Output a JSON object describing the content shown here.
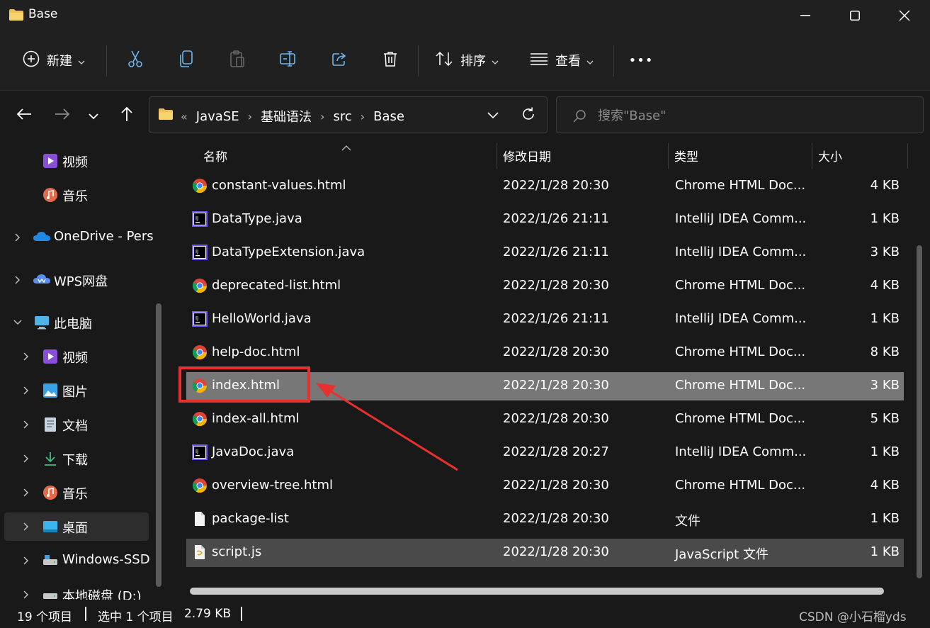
{
  "window": {
    "title": "Base"
  },
  "toolbar": {
    "new_label": "新建",
    "sort_label": "排序",
    "view_label": "查看",
    "more_label": "•••"
  },
  "address": {
    "lead": "«",
    "crumbs": [
      "JavaSE",
      "基础语法",
      "src",
      "Base"
    ]
  },
  "search": {
    "placeholder": "搜索\"Base\""
  },
  "sidebar": {
    "items": [
      {
        "label": "视频",
        "icon": "video-icon"
      },
      {
        "label": "音乐",
        "icon": "music-icon"
      },
      {
        "label": "OneDrive - Pers",
        "icon": "onedrive-icon"
      },
      {
        "label": "WPS网盘",
        "icon": "wps-cloud-icon"
      },
      {
        "label": "此电脑",
        "icon": "computer-icon"
      },
      {
        "label": "视频",
        "icon": "video-icon"
      },
      {
        "label": "图片",
        "icon": "pictures-icon"
      },
      {
        "label": "文档",
        "icon": "documents-icon"
      },
      {
        "label": "下载",
        "icon": "download-icon"
      },
      {
        "label": "音乐",
        "icon": "music-icon"
      },
      {
        "label": "桌面",
        "icon": "desktop-icon"
      },
      {
        "label": "Windows-SSD",
        "icon": "drive-icon"
      },
      {
        "label": "本地磁盘 (D:)",
        "icon": "drive-icon"
      }
    ]
  },
  "columns": {
    "name": "名称",
    "modified": "修改日期",
    "type": "类型",
    "size": "大小"
  },
  "files": [
    {
      "name": "constant-values.html",
      "modified": "2022/1/28 20:30",
      "type": "Chrome HTML Doc...",
      "size": "4 KB",
      "icon": "chrome-icon"
    },
    {
      "name": "DataType.java",
      "modified": "2022/1/26 21:11",
      "type": "IntelliJ IDEA Comm...",
      "size": "1 KB",
      "icon": "intellij-icon"
    },
    {
      "name": "DataTypeExtension.java",
      "modified": "2022/1/26 21:11",
      "type": "IntelliJ IDEA Comm...",
      "size": "3 KB",
      "icon": "intellij-icon"
    },
    {
      "name": "deprecated-list.html",
      "modified": "2022/1/28 20:30",
      "type": "Chrome HTML Doc...",
      "size": "4 KB",
      "icon": "chrome-icon"
    },
    {
      "name": "HelloWorld.java",
      "modified": "2022/1/26 21:11",
      "type": "IntelliJ IDEA Comm...",
      "size": "1 KB",
      "icon": "intellij-icon"
    },
    {
      "name": "help-doc.html",
      "modified": "2022/1/28 20:30",
      "type": "Chrome HTML Doc...",
      "size": "8 KB",
      "icon": "chrome-icon"
    },
    {
      "name": "index.html",
      "modified": "2022/1/28 20:30",
      "type": "Chrome HTML Doc...",
      "size": "3 KB",
      "icon": "chrome-icon"
    },
    {
      "name": "index-all.html",
      "modified": "2022/1/28 20:30",
      "type": "Chrome HTML Doc...",
      "size": "5 KB",
      "icon": "chrome-icon"
    },
    {
      "name": "JavaDoc.java",
      "modified": "2022/1/28 20:27",
      "type": "IntelliJ IDEA Comm...",
      "size": "1 KB",
      "icon": "intellij-icon"
    },
    {
      "name": "overview-tree.html",
      "modified": "2022/1/28 20:30",
      "type": "Chrome HTML Doc...",
      "size": "4 KB",
      "icon": "chrome-icon"
    },
    {
      "name": "package-list",
      "modified": "2022/1/28 20:30",
      "type": "文件",
      "size": "1 KB",
      "icon": "blank-file-icon"
    },
    {
      "name": "script.js",
      "modified": "2022/1/28 20:30",
      "type": "JavaScript 文件",
      "size": "1 KB",
      "icon": "js-file-icon"
    }
  ],
  "status": {
    "count": "19 个项目",
    "selection": "选中 1 个项目",
    "size": "2.79 KB"
  },
  "watermark": "CSDN @小石榴yds",
  "colors": {
    "background": "#191919",
    "selected_row": "#777777",
    "hover_row": "#4a4a4a",
    "annotation": "#e8302e"
  }
}
